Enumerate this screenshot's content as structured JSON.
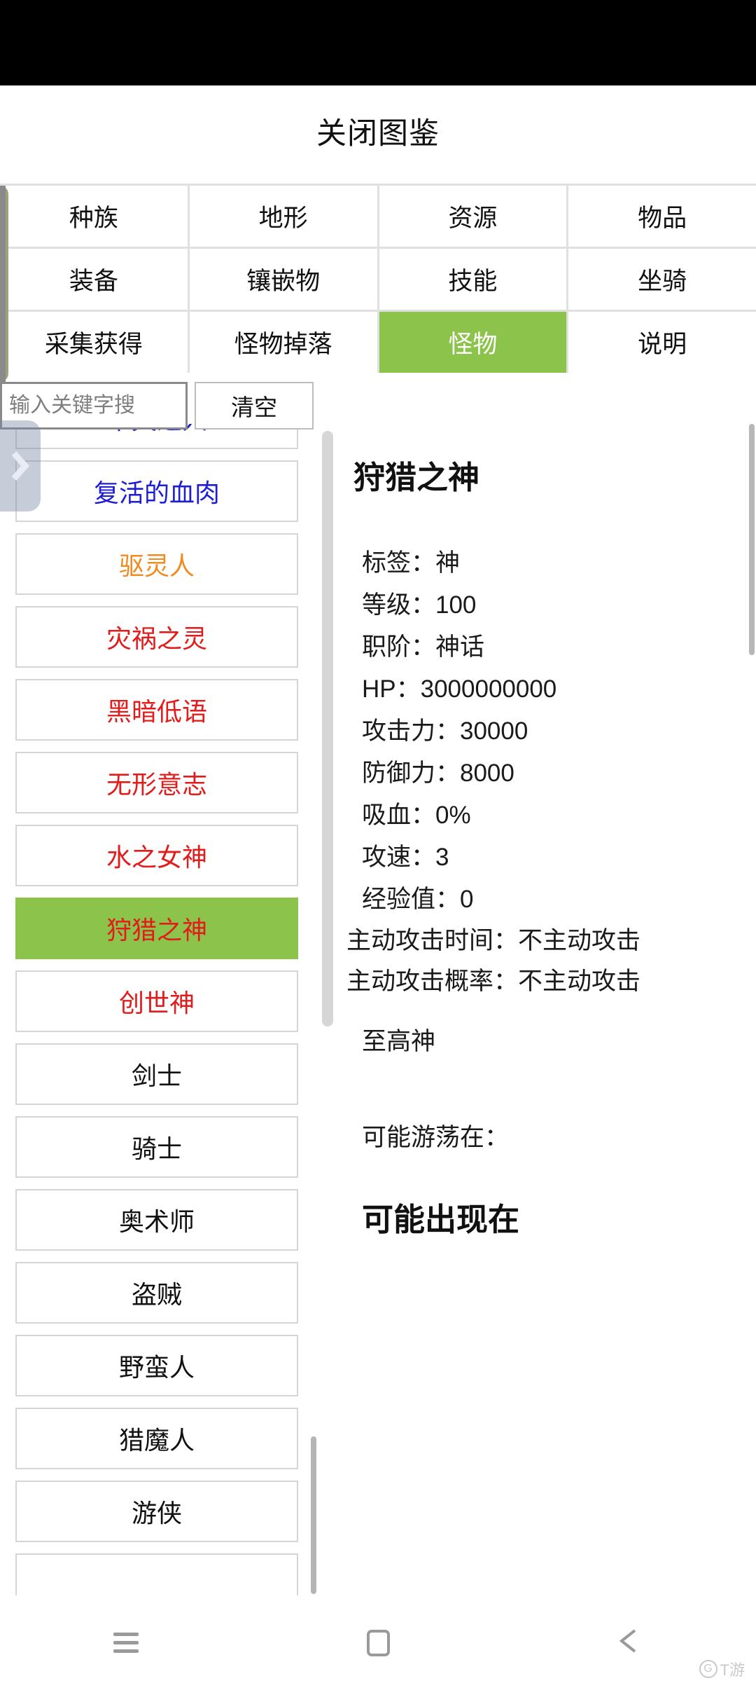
{
  "header": {
    "title": "关闭图鉴"
  },
  "tabs": [
    {
      "label": "种族",
      "active": false
    },
    {
      "label": "地形",
      "active": false
    },
    {
      "label": "资源",
      "active": false
    },
    {
      "label": "物品",
      "active": false
    },
    {
      "label": "装备",
      "active": false
    },
    {
      "label": "镶嵌物",
      "active": false
    },
    {
      "label": "技能",
      "active": false
    },
    {
      "label": "坐骑",
      "active": false
    },
    {
      "label": "采集获得",
      "active": false
    },
    {
      "label": "怪物掉落",
      "active": false
    },
    {
      "label": "怪物",
      "active": true
    },
    {
      "label": "说明",
      "active": false
    }
  ],
  "search": {
    "placeholder": "输入关键字搜",
    "value": "",
    "clear_label": "清空"
  },
  "list": [
    {
      "label": "不灭之人",
      "color": "blue",
      "selected": false
    },
    {
      "label": "复活的血肉",
      "color": "blue",
      "selected": false
    },
    {
      "label": "驱灵人",
      "color": "orange",
      "selected": false
    },
    {
      "label": "灾祸之灵",
      "color": "red",
      "selected": false
    },
    {
      "label": "黑暗低语",
      "color": "red",
      "selected": false
    },
    {
      "label": "无形意志",
      "color": "red",
      "selected": false
    },
    {
      "label": "水之女神",
      "color": "red",
      "selected": false
    },
    {
      "label": "狩猎之神",
      "color": "red",
      "selected": true
    },
    {
      "label": "创世神",
      "color": "red",
      "selected": false
    },
    {
      "label": "剑士",
      "color": "plain",
      "selected": false
    },
    {
      "label": "骑士",
      "color": "plain",
      "selected": false
    },
    {
      "label": "奥术师",
      "color": "plain",
      "selected": false
    },
    {
      "label": "盗贼",
      "color": "plain",
      "selected": false
    },
    {
      "label": "野蛮人",
      "color": "plain",
      "selected": false
    },
    {
      "label": "猎魔人",
      "color": "plain",
      "selected": false
    },
    {
      "label": "游侠",
      "color": "plain",
      "selected": false
    },
    {
      "label": "",
      "color": "plain",
      "selected": false
    }
  ],
  "detail": {
    "name": "狩猎之神",
    "stats": [
      "标签：神",
      "等级：100",
      "职阶：神话",
      "HP：3000000000",
      "攻击力：30000",
      "防御力：8000",
      "吸血：0%",
      "攻速：3",
      "经验值：0"
    ],
    "active_attack_time": "主动攻击时间：不主动攻击",
    "active_attack_rate": "主动攻击概率：不主动攻击",
    "note": "至高神",
    "roam_label": "可能游荡在：",
    "appear_label": "可能出现在"
  },
  "navbar": {
    "recents_label": "recents-icon",
    "home_label": "home-icon",
    "back_label": "back-icon"
  },
  "watermark": {
    "text": "T游"
  },
  "colors": {
    "accent_green": "#8cc34b",
    "link_blue": "#1d1dd6",
    "orange": "#ef8b20",
    "red": "#e21b1b",
    "tab_gap": "#e0e0e0"
  }
}
